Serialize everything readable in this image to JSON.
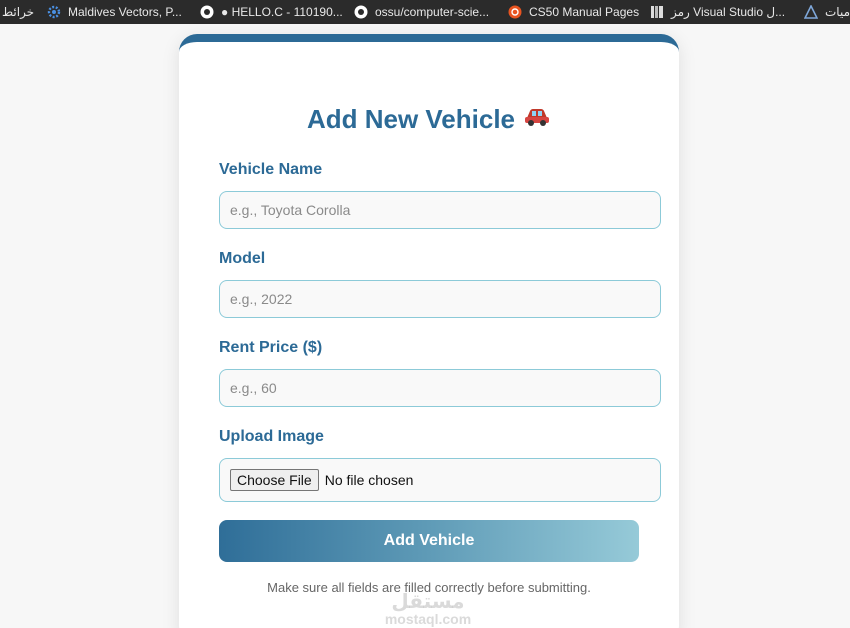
{
  "bookmarks": [
    {
      "label": "خرائط",
      "icon": "none"
    },
    {
      "label": "Maldives Vectors, P...",
      "icon": "gear-icon"
    },
    {
      "label": "● HELLO.C - 110190...",
      "icon": "github-icon"
    },
    {
      "label": "ossu/computer-scie...",
      "icon": "github-icon"
    },
    {
      "label": "CS50 Manual Pages",
      "icon": "ubuntu-icon"
    },
    {
      "label": "رمز Visual Studio ل...",
      "icon": "book-icon"
    },
    {
      "label": "ميات",
      "icon": "triangle-icon"
    }
  ],
  "form": {
    "title": "Add New Vehicle",
    "title_icon": "car-icon",
    "vehicle_name_label": "Vehicle Name",
    "vehicle_name_placeholder": "e.g., Toyota Corolla",
    "model_label": "Model",
    "model_placeholder": "e.g., 2022",
    "rent_price_label": "Rent Price ($)",
    "rent_price_placeholder": "e.g., 60",
    "upload_label": "Upload Image",
    "file_button": "Choose File",
    "file_status": "No file chosen",
    "submit_label": "Add Vehicle",
    "note": "Make sure all fields are filled correctly before submitting."
  },
  "watermark": {
    "arabic": "مستقل",
    "latin": "mostaql.com"
  },
  "colors": {
    "accent": "#2c6a96",
    "border": "#8ccad8",
    "gradient_end": "#96cad8"
  }
}
